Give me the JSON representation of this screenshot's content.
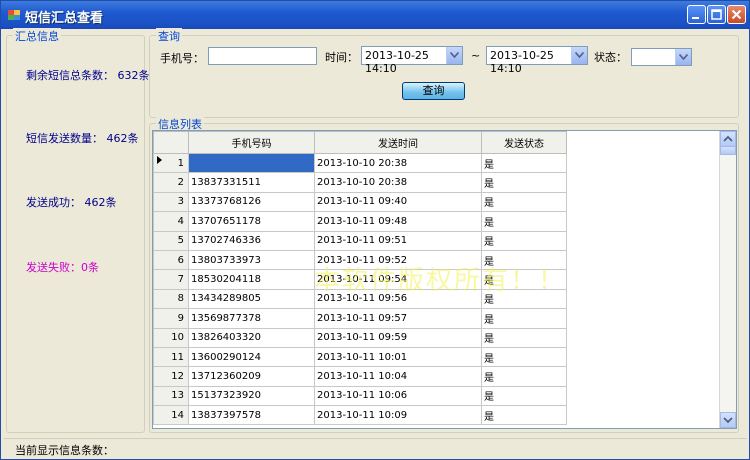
{
  "window": {
    "title": "短信汇总查看"
  },
  "summary": {
    "legend": "汇总信息",
    "remaining": "剩余短信总条数： 632条",
    "sent": "短信发送数量： 462条",
    "success": "发送成功： 462条",
    "failed": "发送失败：0条",
    "colors": {
      "normal": "#00008b",
      "failed": "#cc00cc"
    }
  },
  "query": {
    "legend": "查询",
    "phone_label": "手机号：",
    "phone_value": "",
    "time_label": "时间：",
    "start_time": "2013-10-25 14:10",
    "tilde": "~",
    "end_time": "2013-10-25 14:10",
    "status_label": "状态：",
    "status_value": "",
    "search_button": "查询"
  },
  "list": {
    "legend": "信息列表",
    "columns": [
      "手机号码",
      "发送时间",
      "发送状态"
    ],
    "rows": [
      {
        "n": "1",
        "phone": "",
        "time": "2013-10-10 20:38",
        "status": "是"
      },
      {
        "n": "2",
        "phone": "13837331511",
        "time": "2013-10-10 20:38",
        "status": "是"
      },
      {
        "n": "3",
        "phone": "13373768126",
        "time": "2013-10-11 09:40",
        "status": "是"
      },
      {
        "n": "4",
        "phone": "13707651178",
        "time": "2013-10-11 09:48",
        "status": "是"
      },
      {
        "n": "5",
        "phone": "13702746336",
        "time": "2013-10-11 09:51",
        "status": "是"
      },
      {
        "n": "6",
        "phone": "13803733973",
        "time": "2013-10-11 09:52",
        "status": "是"
      },
      {
        "n": "7",
        "phone": "18530204118",
        "time": "2013-10-11 09:54",
        "status": "是"
      },
      {
        "n": "8",
        "phone": "13434289805",
        "time": "2013-10-11 09:56",
        "status": "是"
      },
      {
        "n": "9",
        "phone": "13569877378",
        "time": "2013-10-11 09:57",
        "status": "是"
      },
      {
        "n": "10",
        "phone": "13826403320",
        "time": "2013-10-11 09:59",
        "status": "是"
      },
      {
        "n": "11",
        "phone": "13600290124",
        "time": "2013-10-11 10:01",
        "status": "是"
      },
      {
        "n": "12",
        "phone": "13712360209",
        "time": "2013-10-11 10:04",
        "status": "是"
      },
      {
        "n": "13",
        "phone": "15137323920",
        "time": "2013-10-11 10:06",
        "status": "是"
      },
      {
        "n": "14",
        "phone": "13837397578",
        "time": "2013-10-11 10:09",
        "status": "是"
      }
    ],
    "watermark": "本软件版权所有！！"
  },
  "status_bar": {
    "label": "当前显示信息条数："
  }
}
